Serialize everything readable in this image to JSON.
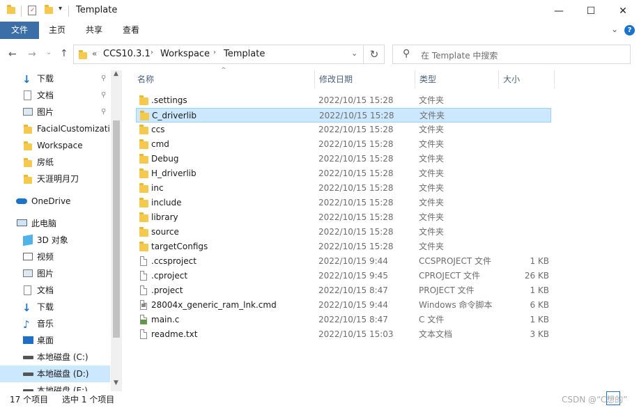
{
  "window": {
    "title": "Template",
    "minimize_glyph": "—",
    "maximize_glyph": "☐",
    "close_glyph": "✕"
  },
  "ribbon": {
    "file_tab": "文件",
    "tabs": [
      "主页",
      "共享",
      "查看"
    ],
    "file_tab_color": "#3c6ea8"
  },
  "nav": {
    "breadcrumb_prefix": "«",
    "breadcrumb": [
      "CCS10.3.1",
      "Workspace",
      "Template"
    ],
    "search_placeholder": "在 Template 中搜索"
  },
  "sidebar": {
    "quick_access": [
      {
        "label": "下载",
        "icon": "download-icon",
        "pinned": true
      },
      {
        "label": "文档",
        "icon": "document-icon",
        "pinned": true
      },
      {
        "label": "图片",
        "icon": "picture-icon",
        "pinned": true
      },
      {
        "label": "FacialCustomizatio",
        "icon": "folder-icon",
        "pinned": false
      },
      {
        "label": "Workspace",
        "icon": "folder-icon",
        "pinned": false
      },
      {
        "label": "房纸",
        "icon": "folder-icon",
        "pinned": false
      },
      {
        "label": "天涯明月刀",
        "icon": "folder-icon",
        "pinned": false
      }
    ],
    "onedrive": "OneDrive",
    "this_pc": "此电脑",
    "pc_items": [
      {
        "label": "3D 对象",
        "icon": "3d-objects-icon"
      },
      {
        "label": "视频",
        "icon": "video-icon"
      },
      {
        "label": "图片",
        "icon": "picture-icon"
      },
      {
        "label": "文档",
        "icon": "document-icon"
      },
      {
        "label": "下载",
        "icon": "download-icon"
      },
      {
        "label": "音乐",
        "icon": "music-icon"
      },
      {
        "label": "桌面",
        "icon": "desktop-icon"
      },
      {
        "label": "本地磁盘 (C:)",
        "icon": "drive-icon"
      },
      {
        "label": "本地磁盘 (D:)",
        "icon": "drive-icon",
        "selected": true
      },
      {
        "label": "本地磁盘 (E:)",
        "icon": "drive-icon"
      }
    ]
  },
  "columns": {
    "name": "名称",
    "date": "修改日期",
    "type": "类型",
    "size": "大小"
  },
  "files": [
    {
      "name": ".settings",
      "date": "2022/10/15 15:28",
      "type": "文件夹",
      "size": "",
      "kind": "folder"
    },
    {
      "name": "C_driverlib",
      "date": "2022/10/15 15:28",
      "type": "文件夹",
      "size": "",
      "kind": "folder",
      "selected": true
    },
    {
      "name": "ccs",
      "date": "2022/10/15 15:28",
      "type": "文件夹",
      "size": "",
      "kind": "folder"
    },
    {
      "name": "cmd",
      "date": "2022/10/15 15:28",
      "type": "文件夹",
      "size": "",
      "kind": "folder"
    },
    {
      "name": "Debug",
      "date": "2022/10/15 15:28",
      "type": "文件夹",
      "size": "",
      "kind": "folder"
    },
    {
      "name": "H_driverlib",
      "date": "2022/10/15 15:28",
      "type": "文件夹",
      "size": "",
      "kind": "folder"
    },
    {
      "name": "inc",
      "date": "2022/10/15 15:28",
      "type": "文件夹",
      "size": "",
      "kind": "folder"
    },
    {
      "name": "include",
      "date": "2022/10/15 15:28",
      "type": "文件夹",
      "size": "",
      "kind": "folder"
    },
    {
      "name": "library",
      "date": "2022/10/15 15:28",
      "type": "文件夹",
      "size": "",
      "kind": "folder"
    },
    {
      "name": "source",
      "date": "2022/10/15 15:28",
      "type": "文件夹",
      "size": "",
      "kind": "folder"
    },
    {
      "name": "targetConfigs",
      "date": "2022/10/15 15:28",
      "type": "文件夹",
      "size": "",
      "kind": "folder"
    },
    {
      "name": ".ccsproject",
      "date": "2022/10/15 9:44",
      "type": "CCSPROJECT 文件",
      "size": "1 KB",
      "kind": "file"
    },
    {
      "name": ".cproject",
      "date": "2022/10/15 9:45",
      "type": "CPROJECT 文件",
      "size": "26 KB",
      "kind": "file"
    },
    {
      "name": ".project",
      "date": "2022/10/15 8:47",
      "type": "PROJECT 文件",
      "size": "1 KB",
      "kind": "file"
    },
    {
      "name": "28004x_generic_ram_lnk.cmd",
      "date": "2022/10/15 9:44",
      "type": "Windows 命令脚本",
      "size": "6 KB",
      "kind": "cmd"
    },
    {
      "name": "main.c",
      "date": "2022/10/15 8:47",
      "type": "C 文件",
      "size": "1 KB",
      "kind": "c"
    },
    {
      "name": "readme.txt",
      "date": "2022/10/15 15:03",
      "type": "文本文档",
      "size": "3 KB",
      "kind": "txt"
    }
  ],
  "status": {
    "count": "17 个项目",
    "selected": "选中 1 个项目",
    "watermark": "CSDN @“C想的”"
  }
}
